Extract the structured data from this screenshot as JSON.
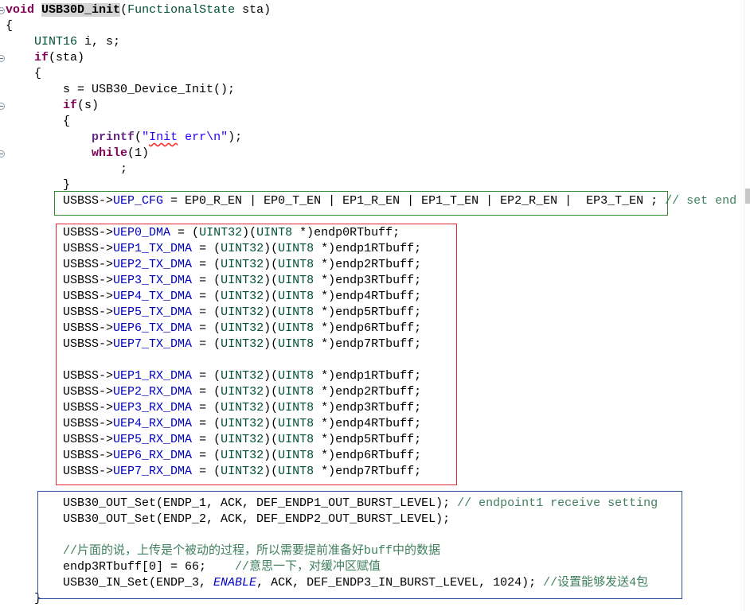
{
  "editor": {
    "fold_icon": "collapse-icon"
  },
  "annotations": {
    "green_box_color": "#2E8B2E",
    "red_box_color": "#E0262E",
    "blue_box_color": "#2A4EA0"
  },
  "code": {
    "lines": [
      {
        "fold": true,
        "tokens": [
          {
            "t": "void",
            "fg": "#7F0055",
            "b": true
          },
          {
            "t": " "
          },
          {
            "t": "USB30D_init",
            "b": true,
            "bg": "#D4D4D4"
          },
          {
            "t": "("
          },
          {
            "t": "FunctionalState",
            "fg": "#005032"
          },
          {
            "t": " sta)"
          }
        ]
      },
      {
        "tokens": [
          {
            "t": "{"
          }
        ]
      },
      {
        "tokens": [
          {
            "t": "    "
          },
          {
            "t": "UINT16",
            "fg": "#005032"
          },
          {
            "t": " i, s;"
          }
        ]
      },
      {
        "fold": true,
        "tokens": [
          {
            "t": "    "
          },
          {
            "t": "if",
            "fg": "#7F0055",
            "b": true
          },
          {
            "t": "(sta)"
          }
        ]
      },
      {
        "tokens": [
          {
            "t": "    {"
          }
        ]
      },
      {
        "tokens": [
          {
            "t": "        s = USB30_Device_Init();"
          }
        ]
      },
      {
        "fold": true,
        "tokens": [
          {
            "t": "        "
          },
          {
            "t": "if",
            "fg": "#7F0055",
            "b": true
          },
          {
            "t": "(s)"
          }
        ]
      },
      {
        "tokens": [
          {
            "t": "        {"
          }
        ]
      },
      {
        "tokens": [
          {
            "t": "            "
          },
          {
            "t": "printf",
            "fg": "#642880",
            "b": true
          },
          {
            "t": "("
          },
          {
            "t": "\"",
            "fg": "#2A00FF"
          },
          {
            "t": "Init",
            "fg": "#2A00FF",
            "u": "#FF2020"
          },
          {
            "t": " err\\n\"",
            "fg": "#2A00FF"
          },
          {
            "t": ");"
          }
        ]
      },
      {
        "fold": true,
        "tokens": [
          {
            "t": "            "
          },
          {
            "t": "while",
            "fg": "#7F0055",
            "b": true
          },
          {
            "t": "(1)"
          }
        ]
      },
      {
        "tokens": [
          {
            "t": "                ;"
          }
        ]
      },
      {
        "tokens": [
          {
            "t": "        }"
          }
        ]
      },
      {
        "tokens": [
          {
            "t": "        USBSS->"
          },
          {
            "t": "UEP_CFG",
            "fg": "#0000C0"
          },
          {
            "t": " = EP0_R_EN | EP0_T_EN | EP1_R_EN | EP1_T_EN | EP2_R_EN |  EP3_T_EN ; "
          },
          {
            "t": "// set end",
            "fg": "#3F7F5F"
          }
        ]
      },
      {
        "tokens": []
      },
      {
        "tokens": [
          {
            "t": "        USBSS->"
          },
          {
            "t": "UEP0_DMA",
            "fg": "#0000C0"
          },
          {
            "t": " = ("
          },
          {
            "t": "UINT32",
            "fg": "#005032"
          },
          {
            "t": ")("
          },
          {
            "t": "UINT8",
            "fg": "#005032"
          },
          {
            "t": " *)endp0RTbuff;"
          }
        ]
      },
      {
        "tokens": [
          {
            "t": "        USBSS->"
          },
          {
            "t": "UEP1_TX_DMA",
            "fg": "#0000C0"
          },
          {
            "t": " = ("
          },
          {
            "t": "UINT32",
            "fg": "#005032"
          },
          {
            "t": ")("
          },
          {
            "t": "UINT8",
            "fg": "#005032"
          },
          {
            "t": " *)endp1RTbuff;"
          }
        ]
      },
      {
        "tokens": [
          {
            "t": "        USBSS->"
          },
          {
            "t": "UEP2_TX_DMA",
            "fg": "#0000C0"
          },
          {
            "t": " = ("
          },
          {
            "t": "UINT32",
            "fg": "#005032"
          },
          {
            "t": ")("
          },
          {
            "t": "UINT8",
            "fg": "#005032"
          },
          {
            "t": " *)endp2RTbuff;"
          }
        ]
      },
      {
        "tokens": [
          {
            "t": "        USBSS->"
          },
          {
            "t": "UEP3_TX_DMA",
            "fg": "#0000C0"
          },
          {
            "t": " = ("
          },
          {
            "t": "UINT32",
            "fg": "#005032"
          },
          {
            "t": ")("
          },
          {
            "t": "UINT8",
            "fg": "#005032"
          },
          {
            "t": " *)endp3RTbuff;"
          }
        ]
      },
      {
        "tokens": [
          {
            "t": "        USBSS->"
          },
          {
            "t": "UEP4_TX_DMA",
            "fg": "#0000C0"
          },
          {
            "t": " = ("
          },
          {
            "t": "UINT32",
            "fg": "#005032"
          },
          {
            "t": ")("
          },
          {
            "t": "UINT8",
            "fg": "#005032"
          },
          {
            "t": " *)endp4RTbuff;"
          }
        ]
      },
      {
        "tokens": [
          {
            "t": "        USBSS->"
          },
          {
            "t": "UEP5_TX_DMA",
            "fg": "#0000C0"
          },
          {
            "t": " = ("
          },
          {
            "t": "UINT32",
            "fg": "#005032"
          },
          {
            "t": ")("
          },
          {
            "t": "UINT8",
            "fg": "#005032"
          },
          {
            "t": " *)endp5RTbuff;"
          }
        ]
      },
      {
        "tokens": [
          {
            "t": "        USBSS->"
          },
          {
            "t": "UEP6_TX_DMA",
            "fg": "#0000C0"
          },
          {
            "t": " = ("
          },
          {
            "t": "UINT32",
            "fg": "#005032"
          },
          {
            "t": ")("
          },
          {
            "t": "UINT8",
            "fg": "#005032"
          },
          {
            "t": " *)endp6RTbuff;"
          }
        ]
      },
      {
        "tokens": [
          {
            "t": "        USBSS->"
          },
          {
            "t": "UEP7_TX_DMA",
            "fg": "#0000C0"
          },
          {
            "t": " = ("
          },
          {
            "t": "UINT32",
            "fg": "#005032"
          },
          {
            "t": ")("
          },
          {
            "t": "UINT8",
            "fg": "#005032"
          },
          {
            "t": " *)endp7RTbuff;"
          }
        ]
      },
      {
        "tokens": []
      },
      {
        "tokens": [
          {
            "t": "        USBSS->"
          },
          {
            "t": "UEP1_RX_DMA",
            "fg": "#0000C0"
          },
          {
            "t": " = ("
          },
          {
            "t": "UINT32",
            "fg": "#005032"
          },
          {
            "t": ")("
          },
          {
            "t": "UINT8",
            "fg": "#005032"
          },
          {
            "t": " *)endp1RTbuff;"
          }
        ]
      },
      {
        "tokens": [
          {
            "t": "        USBSS->"
          },
          {
            "t": "UEP2_RX_DMA",
            "fg": "#0000C0"
          },
          {
            "t": " = ("
          },
          {
            "t": "UINT32",
            "fg": "#005032"
          },
          {
            "t": ")("
          },
          {
            "t": "UINT8",
            "fg": "#005032"
          },
          {
            "t": " *)endp2RTbuff;"
          }
        ]
      },
      {
        "tokens": [
          {
            "t": "        USBSS->"
          },
          {
            "t": "UEP3_RX_DMA",
            "fg": "#0000C0"
          },
          {
            "t": " = ("
          },
          {
            "t": "UINT32",
            "fg": "#005032"
          },
          {
            "t": ")("
          },
          {
            "t": "UINT8",
            "fg": "#005032"
          },
          {
            "t": " *)endp3RTbuff;"
          }
        ]
      },
      {
        "tokens": [
          {
            "t": "        USBSS->"
          },
          {
            "t": "UEP4_RX_DMA",
            "fg": "#0000C0"
          },
          {
            "t": " = ("
          },
          {
            "t": "UINT32",
            "fg": "#005032"
          },
          {
            "t": ")("
          },
          {
            "t": "UINT8",
            "fg": "#005032"
          },
          {
            "t": " *)endp4RTbuff;"
          }
        ]
      },
      {
        "tokens": [
          {
            "t": "        USBSS->"
          },
          {
            "t": "UEP5_RX_DMA",
            "fg": "#0000C0"
          },
          {
            "t": " = ("
          },
          {
            "t": "UINT32",
            "fg": "#005032"
          },
          {
            "t": ")("
          },
          {
            "t": "UINT8",
            "fg": "#005032"
          },
          {
            "t": " *)endp5RTbuff;"
          }
        ]
      },
      {
        "tokens": [
          {
            "t": "        USBSS->"
          },
          {
            "t": "UEP6_RX_DMA",
            "fg": "#0000C0"
          },
          {
            "t": " = ("
          },
          {
            "t": "UINT32",
            "fg": "#005032"
          },
          {
            "t": ")("
          },
          {
            "t": "UINT8",
            "fg": "#005032"
          },
          {
            "t": " *)endp6RTbuff;"
          }
        ]
      },
      {
        "tokens": [
          {
            "t": "        USBSS->"
          },
          {
            "t": "UEP7_RX_DMA",
            "fg": "#0000C0"
          },
          {
            "t": " = ("
          },
          {
            "t": "UINT32",
            "fg": "#005032"
          },
          {
            "t": ")("
          },
          {
            "t": "UINT8",
            "fg": "#005032"
          },
          {
            "t": " *)endp7RTbuff;"
          }
        ]
      },
      {
        "tokens": []
      },
      {
        "tokens": [
          {
            "t": "        USB30_OUT_Set(ENDP_1, ACK, DEF_ENDP1_OUT_BURST_LEVEL); "
          },
          {
            "t": "// endpoint1 receive setting",
            "fg": "#3F7F5F"
          }
        ]
      },
      {
        "tokens": [
          {
            "t": "        USB30_OUT_Set(ENDP_2, ACK, DEF_ENDP2_OUT_BURST_LEVEL);"
          }
        ]
      },
      {
        "tokens": []
      },
      {
        "tokens": [
          {
            "t": "        "
          },
          {
            "t": "//片面的说，上传是个被动的过程，所以需要提前准备好buff中的数据",
            "fg": "#3F7F5F"
          }
        ]
      },
      {
        "tokens": [
          {
            "t": "        endp3RTbuff[0] = 66;    "
          },
          {
            "t": "//意思一下，对缓冲区赋值",
            "fg": "#3F7F5F"
          }
        ]
      },
      {
        "tokens": [
          {
            "t": "        USB30_IN_Set(ENDP_3, "
          },
          {
            "t": "ENABLE",
            "fg": "#0000C0",
            "i": true
          },
          {
            "t": ", ACK, DEF_ENDP3_IN_BURST_LEVEL, 1024); "
          },
          {
            "t": "//设置能够发送4包",
            "fg": "#3F7F5F"
          }
        ]
      },
      {
        "tokens": [
          {
            "t": "    }"
          }
        ]
      }
    ]
  }
}
